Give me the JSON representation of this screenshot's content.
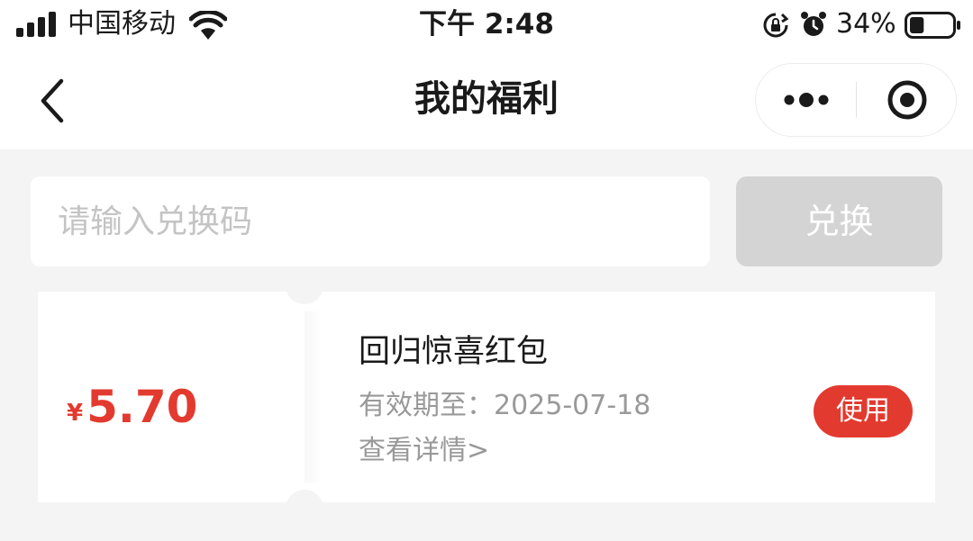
{
  "status_bar": {
    "carrier": "中国移动",
    "time": "下午 2:48",
    "battery_percent": "34%",
    "battery_level": 0.34,
    "icons": [
      "signal-icon",
      "wifi-icon",
      "orientation-lock-icon",
      "alarm-icon",
      "battery-icon"
    ]
  },
  "nav": {
    "title": "我的福利",
    "back_icon": "chevron-left-icon",
    "capsule_icons": [
      "more-dots-icon",
      "close-target-icon"
    ]
  },
  "redeem": {
    "placeholder": "请输入兑换码",
    "value": "",
    "button_label": "兑换"
  },
  "coupons": [
    {
      "currency": "¥",
      "amount": "5.70",
      "title": "回归惊喜红包",
      "expiry": "有效期至：2025-07-18",
      "detail_link": "查看详情>",
      "action_label": "使用"
    }
  ],
  "colors": {
    "accent": "#e33a2f",
    "page_background": "#f4f4f4",
    "disabled_button": "#d4d4d4",
    "muted_text": "#999999"
  }
}
